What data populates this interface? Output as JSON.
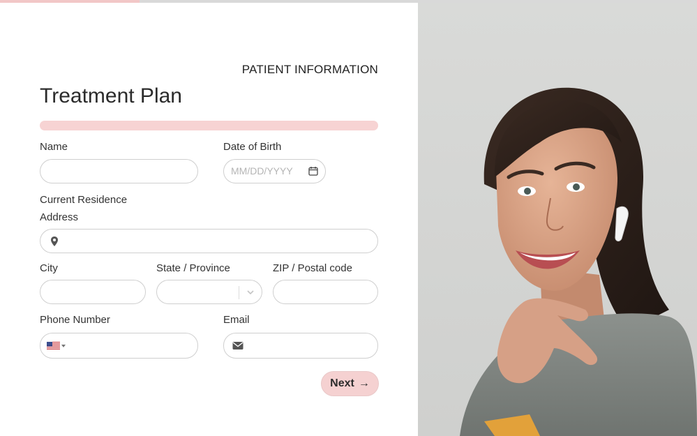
{
  "progress": {
    "fraction": 0.2,
    "fill_color": "#f2c7c7",
    "track_color": "#d9d9d9"
  },
  "header": {
    "step_label": "PATIENT INFORMATION",
    "title": "Treatment Plan"
  },
  "accent_color": "#f5d1d1",
  "fields": {
    "name": {
      "label": "Name",
      "value": ""
    },
    "dob": {
      "label": "Date of Birth",
      "placeholder": "MM/DD/YYYY",
      "icon": "calendar-icon"
    },
    "residence": {
      "heading": "Current Residence"
    },
    "address": {
      "label": "Address",
      "value": "",
      "icon": "location-pin-icon"
    },
    "city": {
      "label": "City",
      "value": ""
    },
    "state": {
      "label": "State / Province",
      "value": "",
      "icon": "chevron-down-icon"
    },
    "zip": {
      "label": "ZIP / Postal code",
      "value": ""
    },
    "phone": {
      "label": "Phone Number",
      "value": "",
      "country_icon": "us-flag-icon"
    },
    "email": {
      "label": "Email",
      "value": "",
      "icon": "envelope-icon"
    }
  },
  "actions": {
    "next_label": "Next",
    "next_icon": "arrow-right-icon"
  },
  "photo": {
    "subject": "smiling-woman-with-earbud"
  }
}
